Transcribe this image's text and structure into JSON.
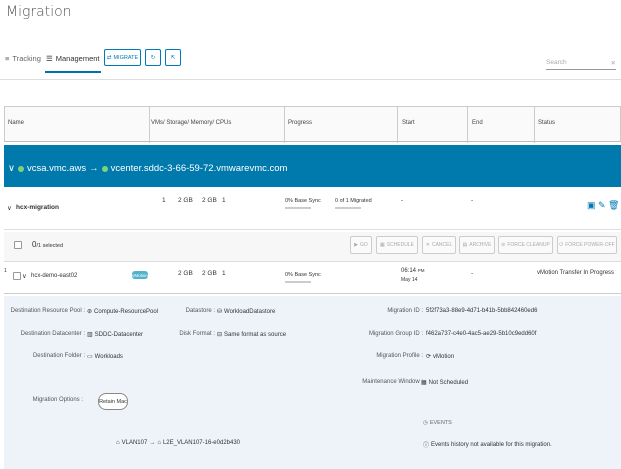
{
  "page": {
    "title": "Migration"
  },
  "tabs": [
    {
      "label": "Tracking",
      "active": false
    },
    {
      "label": "Management",
      "active": true
    }
  ],
  "toolbar": {
    "migrate_label": "MIGRATE"
  },
  "search": {
    "placeholder": "Search"
  },
  "table": {
    "columns": [
      "Name",
      "VMs/ Storage/ Memory/ CPUs",
      "Progress",
      "Start",
      "End",
      "Status"
    ]
  },
  "banner": {
    "source": "vcsa.vmc.aws",
    "arrow": "→",
    "destination": "vcenter.sddc-3-66-59-72.vmwarevmc.com"
  },
  "group": {
    "name": "hcx-migration",
    "vms": "1",
    "storage": "2 GB",
    "memory": "2 GB",
    "cpus": "1",
    "progress_pct": "0%",
    "progress_phase": "Base Sync",
    "progress_count": "0 of 1 Migrated",
    "start": "-",
    "end": "-"
  },
  "selection": {
    "count_prefix": "0",
    "count_suffix": "/1 selected",
    "actions": [
      "GO",
      "SCHEDULE",
      "CANCEL",
      "ARCHIVE",
      "FORCE CLEANUP",
      "FORCE POWER-OFF"
    ]
  },
  "vm_row": {
    "index": "1",
    "name": "hcx-demo-east02",
    "badge": "vMotion",
    "storage": "2 GB",
    "memory": "2 GB",
    "cpus": "1",
    "progress_pct": "0%",
    "progress_phase": "Base Sync",
    "start_time": "06:14",
    "start_ampm": "PM",
    "start_date": "May 14",
    "end": "-",
    "status": "vMotion Transfer In Progress"
  },
  "details": {
    "dest_resource_pool_label": "Destination Resource Pool :",
    "dest_resource_pool": "Compute-ResourcePool",
    "dest_datacenter_label": "Destination Datacenter :",
    "dest_datacenter": "SDDC-Datacenter",
    "dest_folder_label": "Destination Folder :",
    "dest_folder": "Workloads",
    "datastore_label": "Datastore :",
    "datastore": "WorkloadDatastore",
    "disk_format_label": "Disk Format :",
    "disk_format": "Same format as source",
    "migration_id_label": "Migration ID :",
    "migration_id": "5f2f73a3-88e9-4d71-b41b-5bb842460ed6",
    "migration_group_id_label": "Migration Group ID :",
    "migration_group_id": "f462a737-c4e0-4ac5-ae29-5b10c9edd60f",
    "migration_profile_label": "Migration Profile :",
    "migration_profile": "vMotion",
    "maintenance_window_label": "Maintenance Window :",
    "maintenance_window": "Not Scheduled",
    "migration_options_label": "Migration Options :",
    "retain_mac": "Retain Mac",
    "network_source": "VLAN107",
    "network_arrow": "→",
    "network_dest": "L2E_VLAN107-16-e0d2b430",
    "events_label": "EVENTS",
    "events_text": "Events history not available for this migration."
  },
  "colors": {
    "banner": "#0079ad",
    "accent": "#0079b8",
    "detail_bg": "#eef3fa"
  }
}
